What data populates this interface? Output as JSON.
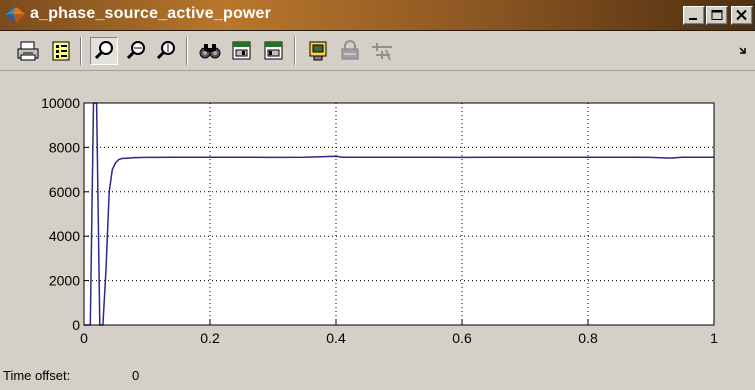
{
  "window": {
    "title": "a_phase_source_active_power"
  },
  "toolbar": {
    "buttons": [
      {
        "name": "print-icon"
      },
      {
        "name": "parameters-icon"
      },
      {
        "name": "zoom-icon",
        "pressed": true
      },
      {
        "name": "zoom-x-icon"
      },
      {
        "name": "zoom-y-icon"
      },
      {
        "name": "autoscale-icon"
      },
      {
        "name": "save-axes-icon"
      },
      {
        "name": "restore-axes-icon"
      },
      {
        "name": "floating-scope-icon"
      },
      {
        "name": "lock-axes-icon"
      },
      {
        "name": "signal-selector-icon"
      }
    ]
  },
  "status": {
    "label": "Time offset:",
    "value": "0"
  },
  "colors": {
    "plot_bg": "#ffffff",
    "trace": "#2a2a88",
    "grid": "#000000"
  },
  "chart_data": {
    "type": "line",
    "title": "",
    "xlabel": "",
    "ylabel": "",
    "xlim": [
      0,
      1
    ],
    "ylim": [
      0,
      10000
    ],
    "x_ticks": [
      "0",
      "0.2",
      "0.4",
      "0.6",
      "0.8",
      "1"
    ],
    "y_ticks": [
      "0",
      "2000",
      "4000",
      "6000",
      "8000",
      "10000"
    ],
    "grid": true,
    "series": [
      {
        "x": [
          0,
          0.01,
          0.015,
          0.02,
          0.025,
          0.03,
          0.035,
          0.04,
          0.045,
          0.05,
          0.055,
          0.06,
          0.07,
          0.08,
          0.1,
          0.15,
          0.2,
          0.25,
          0.3,
          0.35,
          0.4,
          0.41,
          0.45,
          0.5,
          0.55,
          0.6,
          0.65,
          0.7,
          0.75,
          0.8,
          0.85,
          0.9,
          0.93,
          0.95,
          1.0
        ],
        "y": [
          0,
          0,
          10000,
          10000,
          0,
          0,
          2500,
          6000,
          7000,
          7300,
          7450,
          7500,
          7520,
          7540,
          7550,
          7560,
          7560,
          7560,
          7550,
          7560,
          7600,
          7560,
          7560,
          7560,
          7560,
          7550,
          7560,
          7560,
          7560,
          7560,
          7560,
          7550,
          7520,
          7560,
          7560
        ]
      }
    ]
  }
}
